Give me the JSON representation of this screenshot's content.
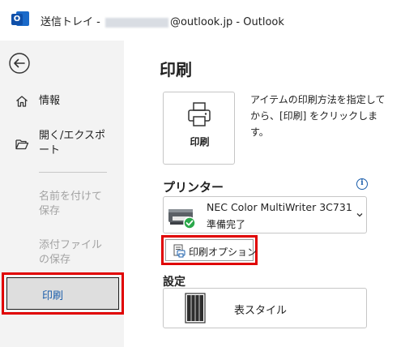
{
  "window": {
    "title_prefix": "送信トレイ - ",
    "title_suffix": "@outlook.jp  -  Outlook",
    "app_icon_letter": "O"
  },
  "sidebar": {
    "back_icon": "arrow-left-circle-icon",
    "items": [
      {
        "label": "情報",
        "icon": "home-icon",
        "enabled": true
      },
      {
        "label": "開く/エクスポート",
        "icon": "folder-open-icon",
        "enabled": true
      },
      {
        "label": "名前を付けて保存",
        "enabled": false
      },
      {
        "label": "添付ファイルの保存",
        "enabled": false
      },
      {
        "label": "印刷",
        "enabled": true,
        "selected": true
      }
    ]
  },
  "main": {
    "title": "印刷",
    "print_button_label": "印刷",
    "description": "アイテムの印刷方法を指定してから、[印刷] をクリックします。",
    "printer_section_label": "プリンター",
    "printer_name": "NEC Color MultiWriter 3C731",
    "printer_status": "準備完了",
    "print_options_label": "印刷オプション",
    "settings_section_label": "設定",
    "style_label": "表スタイル"
  },
  "colors": {
    "accent": "#1a5dab",
    "highlight_box": "#e00000",
    "sidebar_bg": "#f3f3f3",
    "status_ok": "#2aa84a"
  }
}
